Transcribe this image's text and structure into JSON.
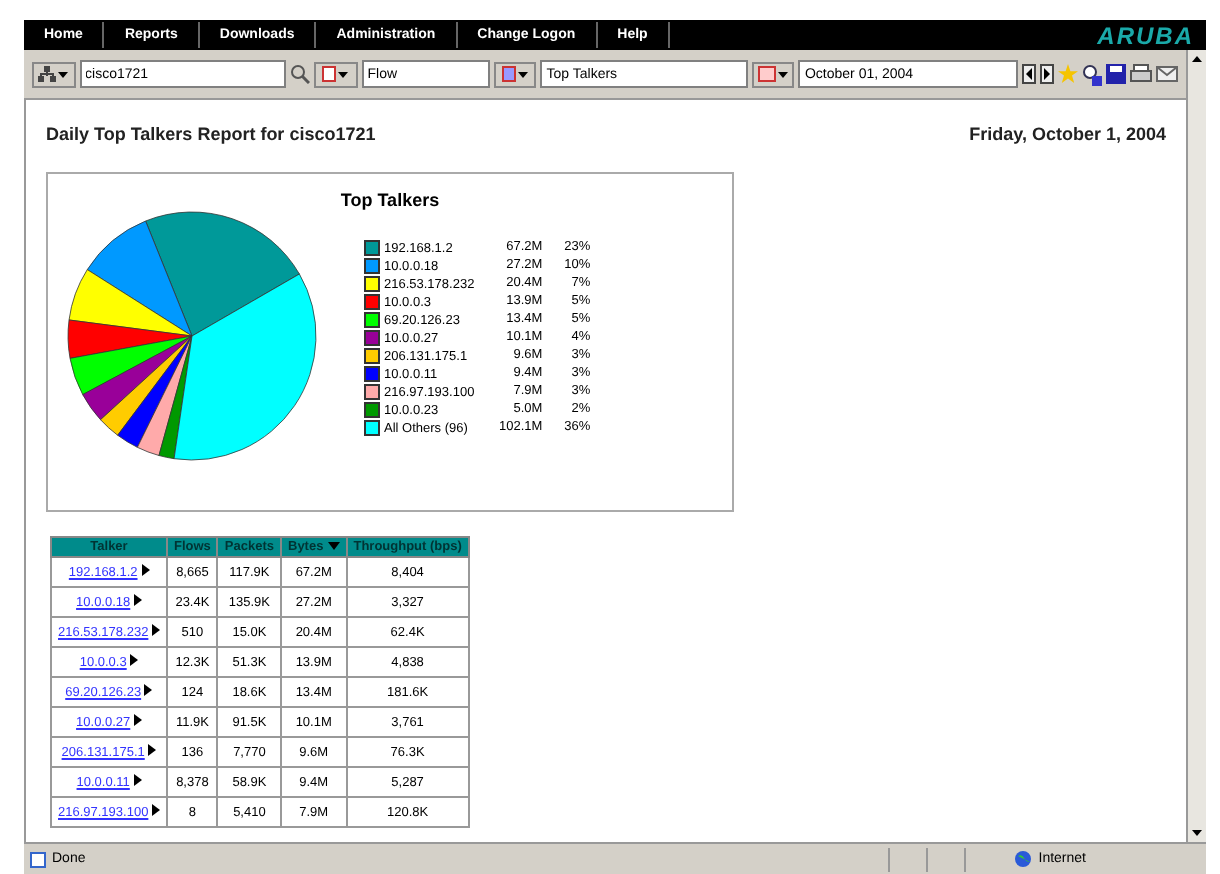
{
  "nav": {
    "items": [
      "Home",
      "Reports",
      "Downloads",
      "Administration",
      "Change Logon",
      "Help"
    ],
    "logo": "ARUBA"
  },
  "toolbar": {
    "device": "cisco1721",
    "type": "Flow",
    "report": "Top Talkers",
    "date": "October 01, 2004"
  },
  "report": {
    "title": "Daily Top Talkers Report for cisco1721",
    "date": "Friday, October 1, 2004"
  },
  "chart": {
    "chart_data": {
      "type": "pie",
      "title": "Top Talkers",
      "categories": [
        "192.168.1.2",
        "10.0.0.18",
        "216.53.178.232",
        "10.0.0.3",
        "69.20.126.23",
        "10.0.0.27",
        "206.131.175.1",
        "10.0.0.11",
        "216.97.193.100",
        "10.0.0.23",
        "All Others (96)"
      ],
      "values": [
        23,
        10,
        7,
        5,
        5,
        4,
        3,
        3,
        3,
        2,
        36
      ]
    },
    "legend": [
      {
        "value": "67.2M",
        "percent": "23%",
        "color": "#009999"
      },
      {
        "value": "27.2M",
        "percent": "10%",
        "color": "#0099ff"
      },
      {
        "value": "20.4M",
        "percent": "7%",
        "color": "#ffff00"
      },
      {
        "value": "13.9M",
        "percent": "5%",
        "color": "#ff0000"
      },
      {
        "value": "13.4M",
        "percent": "5%",
        "color": "#00ff00"
      },
      {
        "value": "10.1M",
        "percent": "4%",
        "color": "#990099"
      },
      {
        "value": "9.6M",
        "percent": "3%",
        "color": "#ffcc00"
      },
      {
        "value": "9.4M",
        "percent": "3%",
        "color": "#0000ff"
      },
      {
        "value": "7.9M",
        "percent": "3%",
        "color": "#ffaaaa"
      },
      {
        "value": "5.0M",
        "percent": "2%",
        "color": "#009900"
      },
      {
        "value": "102.1M",
        "percent": "36%",
        "color": "#00ffff"
      }
    ]
  },
  "table": {
    "columns": [
      {
        "label": "Talker",
        "sorted": false
      },
      {
        "label": "Flows",
        "sorted": false
      },
      {
        "label": "Packets",
        "sorted": false
      },
      {
        "label": "Bytes",
        "sorted": true
      },
      {
        "label": "Throughput (bps)",
        "sorted": false
      }
    ],
    "rows": [
      [
        "192.168.1.2",
        "8,665",
        "117.9K",
        "67.2M",
        "8,404"
      ],
      [
        "10.0.0.18",
        "23.4K",
        "135.9K",
        "27.2M",
        "3,327"
      ],
      [
        "216.53.178.232",
        "510",
        "15.0K",
        "20.4M",
        "62.4K"
      ],
      [
        "10.0.0.3",
        "12.3K",
        "51.3K",
        "13.9M",
        "4,838"
      ],
      [
        "69.20.126.23",
        "124",
        "18.6K",
        "13.4M",
        "181.6K"
      ],
      [
        "10.0.0.27",
        "11.9K",
        "91.5K",
        "10.1M",
        "3,761"
      ],
      [
        "206.131.175.1",
        "136",
        "7,770",
        "9.6M",
        "76.3K"
      ],
      [
        "10.0.0.11",
        "8,378",
        "58.9K",
        "9.4M",
        "5,287"
      ],
      [
        "216.97.193.100",
        "8",
        "5,410",
        "7.9M",
        "120.8K"
      ]
    ]
  },
  "status_bar": {
    "text": "Done",
    "zone": "Internet"
  }
}
